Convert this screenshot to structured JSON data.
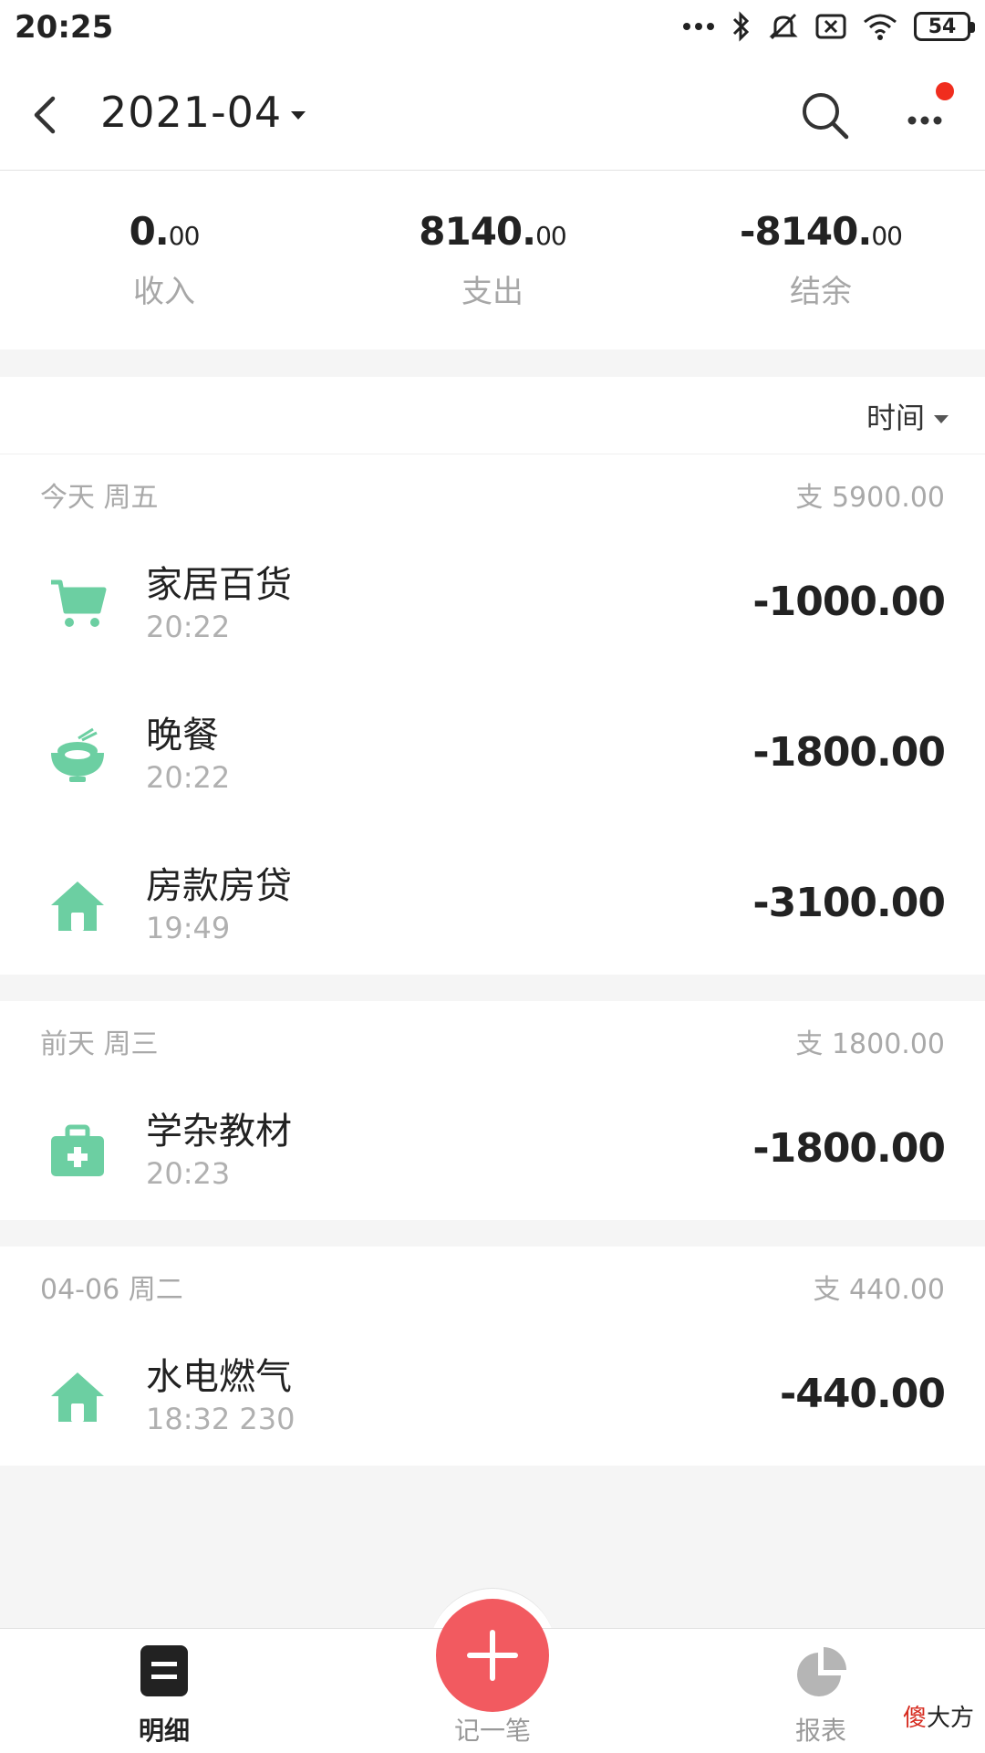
{
  "status_bar": {
    "time": "20:25",
    "battery": "54",
    "icons": [
      "more-dots-icon",
      "bluetooth-icon",
      "mute-icon",
      "sim-off-icon",
      "wifi-icon",
      "battery-icon"
    ]
  },
  "header": {
    "back_icon": "back-arrow-icon",
    "month": "2021-04",
    "search_icon": "search-icon",
    "more_icon": "more-icon",
    "notification_dot_color": "#f02d1e"
  },
  "summary": {
    "income": {
      "integer": "0.",
      "decimal": "00",
      "label": "收入"
    },
    "expense": {
      "integer": "8140.",
      "decimal": "00",
      "label": "支出"
    },
    "balance": {
      "integer": "-8140.",
      "decimal": "00",
      "label": "结余"
    }
  },
  "sort": {
    "label": "时间"
  },
  "groups": [
    {
      "date": "今天 周五",
      "total": "支 5900.00",
      "items": [
        {
          "name": "家居百货",
          "time": "20:22",
          "amount": "-1000.00",
          "icon": "shopping-cart-icon"
        },
        {
          "name": "晚餐",
          "time": "20:22",
          "amount": "-1800.00",
          "icon": "rice-bowl-icon"
        },
        {
          "name": "房款房贷",
          "time": "19:49",
          "amount": "-3100.00",
          "icon": "house-icon"
        }
      ]
    },
    {
      "date": "前天 周三",
      "total": "支 1800.00",
      "items": [
        {
          "name": "学杂教材",
          "time": "20:23",
          "amount": "-1800.00",
          "icon": "medical-kit-icon"
        }
      ]
    },
    {
      "date": "04-06 周二",
      "total": "支 440.00",
      "items": [
        {
          "name": "水电燃气",
          "time": "18:32 230",
          "amount": "-440.00",
          "icon": "house-icon"
        }
      ]
    }
  ],
  "tabbar": {
    "detail": {
      "label": "明细",
      "icon": "detail-list-icon"
    },
    "add": {
      "label": "记一笔",
      "icon": "plus-icon"
    },
    "report": {
      "label": "报表",
      "icon": "pie-chart-icon"
    }
  },
  "watermark": {
    "red": "傻",
    "black": "大方"
  },
  "colors": {
    "accent_green": "#6ccfa2",
    "fab_red": "#f25a60",
    "muted_text": "#a9a9a9"
  }
}
